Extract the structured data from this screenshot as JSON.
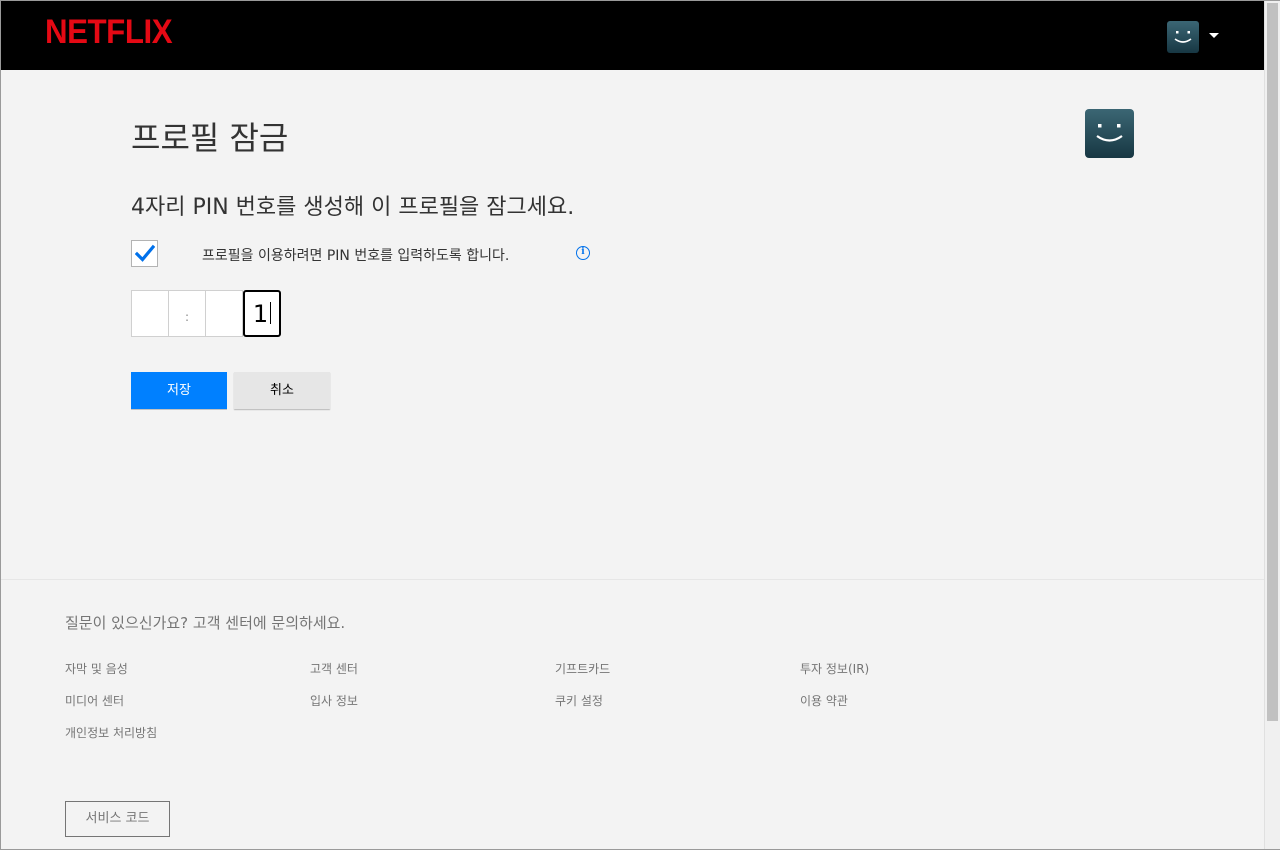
{
  "header": {
    "logo": "NETFLIX",
    "profile_icon": "smiley-avatar-icon",
    "menu_icon": "caret-down-icon"
  },
  "main": {
    "title": "프로필 잠금",
    "subtitle": "4자리 PIN 번호를 생성해 이 프로필을 잠그세요.",
    "checkbox": {
      "checked": true,
      "label": "프로필을 이용하려면 PIN 번호를 입력하도록 합니다."
    },
    "pin": {
      "digits": [
        "",
        "",
        "",
        "1"
      ],
      "separator": ":"
    },
    "save_label": "저장",
    "cancel_label": "취소"
  },
  "footer": {
    "question": "질문이 있으신가요? 고객 센터에 문의하세요.",
    "links": {
      "col1": [
        "자막 및 음성",
        "미디어 센터",
        "개인정보 처리방침"
      ],
      "col2": [
        "고객 센터",
        "입사 정보"
      ],
      "col3": [
        "기프트카드",
        "쿠키 설정"
      ],
      "col4": [
        "투자 정보(IR)",
        "이용 약관"
      ]
    },
    "service_code": "서비스 코드"
  },
  "colors": {
    "brand": "#e50914",
    "primary_button": "#0080ff",
    "info": "#0071eb",
    "avatar_top": "#2b4a57",
    "avatar_bottom": "#14323d"
  }
}
